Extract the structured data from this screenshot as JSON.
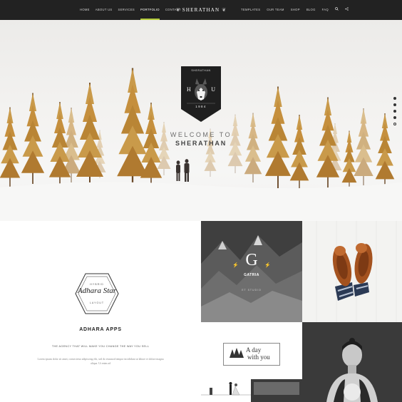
{
  "nav": {
    "left_items": [
      {
        "label": "Home",
        "active": false
      },
      {
        "label": "About Us",
        "active": false
      },
      {
        "label": "Services",
        "active": false
      },
      {
        "label": "Portfolio",
        "active": true
      },
      {
        "label": "Contact",
        "active": false
      }
    ],
    "logo": "SHERATHAN",
    "right_items": [
      {
        "label": "Templates"
      },
      {
        "label": "Our Team"
      },
      {
        "label": "Shop"
      },
      {
        "label": "Blog"
      },
      {
        "label": "FAQ"
      }
    ],
    "icons": [
      "search-icon",
      "share-icon"
    ],
    "accent_color": "#b5cc3a"
  },
  "hero": {
    "badge": {
      "top": "SHERATHAN",
      "left_letter": "H",
      "right_letter": "U",
      "year": "1984"
    },
    "welcome": "WELCOME TO",
    "brand": "SHERATHAN",
    "slide_dots": 5,
    "current_dot": 5
  },
  "apps": {
    "hex_top": "HYBRID",
    "hex_script": "Adhara Star",
    "hex_bottom": "LAYOUT",
    "title": "ADHARA APPS",
    "tagline": "THE AGENCY THAT WILL MAKE YOU CHANGE THE WAY YOU SELL",
    "body": "Lorem ipsum dolor sit amet, consectetur adipiscing elit, sed do eiusmod tempor incididunt ut labore et dolore magna aliqua. Ut enim ad"
  },
  "tiles": {
    "gatria": {
      "letter": "G",
      "name": "GATRIA",
      "sub": "ET STUDIO"
    },
    "aday": {
      "line1": "A day",
      "line2": "with you"
    }
  }
}
